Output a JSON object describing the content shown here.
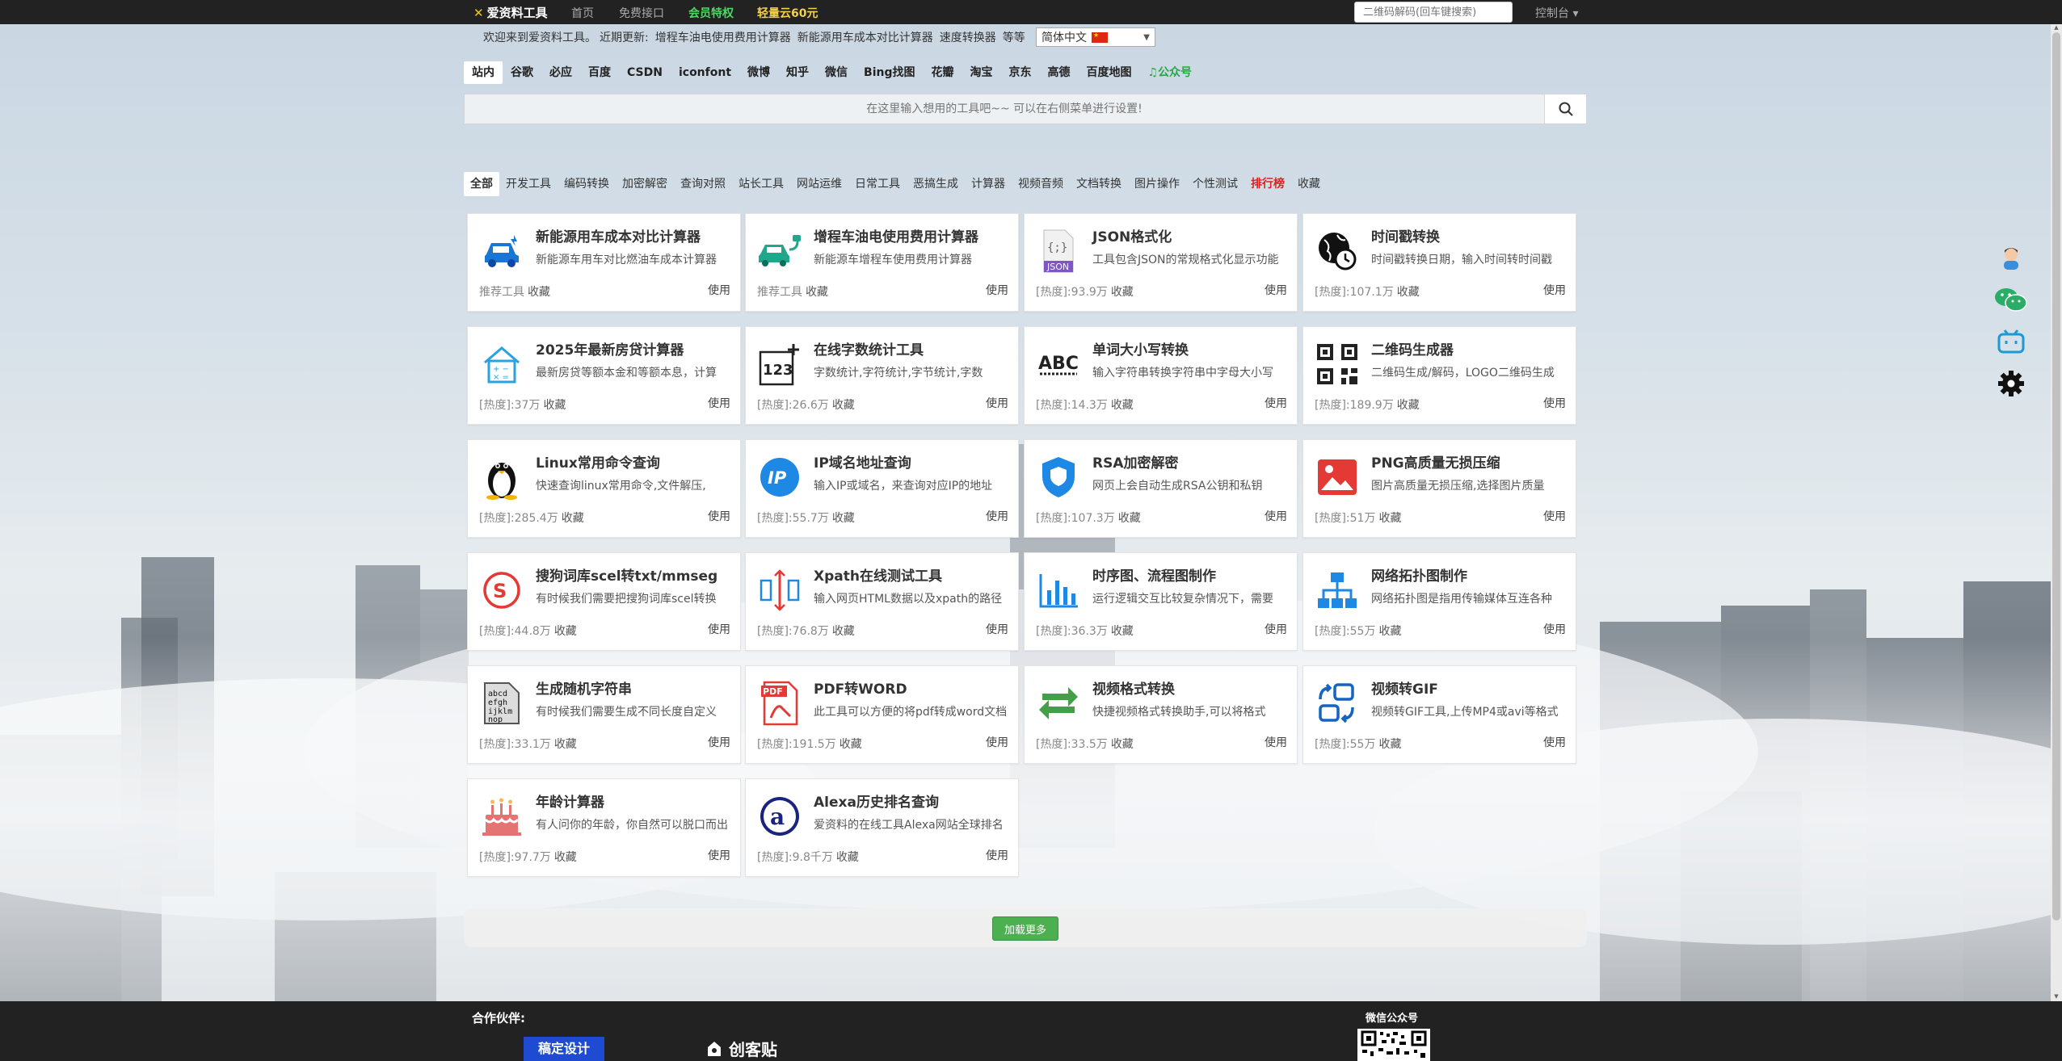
{
  "topbar": {
    "logo": "爱资料工具",
    "nav": [
      "首页",
      "免费接口",
      "会员特权",
      "轻量云60元"
    ],
    "qr_search_placeholder": "二维码解码(回车键搜索)",
    "console": "控制台 ▾"
  },
  "announce": {
    "welcome": "欢迎来到爱资料工具。",
    "recent_label": "近期更新:",
    "items": [
      "增程车油电使用费用计算器",
      "新能源用车成本对比计算器",
      "速度转换器",
      "等等"
    ],
    "language": "简体中文"
  },
  "engines": [
    "站内",
    "谷歌",
    "必应",
    "百度",
    "CSDN",
    "iconfont",
    "微博",
    "知乎",
    "微信",
    "Bing找图",
    "花瓣",
    "淘宝",
    "京东",
    "高德",
    "百度地图",
    "公众号"
  ],
  "search": {
    "placeholder": "在这里输入想用的工具吧~~ 可以在右侧菜单进行设置!"
  },
  "categories": [
    "全部",
    "开发工具",
    "编码转换",
    "加密解密",
    "查询对照",
    "站长工具",
    "网站运维",
    "日常工具",
    "恶搞生成",
    "计算器",
    "视频音频",
    "文档转换",
    "图片操作",
    "个性测试",
    "排行榜",
    "收藏"
  ],
  "cards": [
    {
      "title": "新能源用车成本对比计算器",
      "desc": "新能源车用车对比燃油车成本计算器",
      "meta": "推荐工具",
      "fav": "收藏",
      "use": "使用",
      "icon": "car-icon"
    },
    {
      "title": "增程车油电使用费用计算器",
      "desc": "新能源车增程车使用费用计算器",
      "meta": "推荐工具",
      "fav": "收藏",
      "use": "使用",
      "icon": "ev-charge-icon"
    },
    {
      "title": "JSON格式化",
      "desc": "工具包含JSON的常规格式化显示功能",
      "meta": "[热度]:93.9万",
      "fav": "收藏",
      "use": "使用",
      "icon": "json-file-icon"
    },
    {
      "title": "时间戳转换",
      "desc": "时间戳转换日期，输入时间转时间戳",
      "meta": "[热度]:107.1万",
      "fav": "收藏",
      "use": "使用",
      "icon": "globe-clock-icon"
    },
    {
      "title": "2025年最新房贷计算器",
      "desc": "最新房贷等额本金和等额本息，计算",
      "meta": "[热度]:37万",
      "fav": "收藏",
      "use": "使用",
      "icon": "house-calc-icon"
    },
    {
      "title": "在线字数统计工具",
      "desc": "字数统计,字符统计,字节统计,字数",
      "meta": "[热度]:26.6万",
      "fav": "收藏",
      "use": "使用",
      "icon": "count-123-icon"
    },
    {
      "title": "单词大小写转换",
      "desc": "输入字符串转换字符串中字母大小写",
      "meta": "[热度]:14.3万",
      "fav": "收藏",
      "use": "使用",
      "icon": "abc-icon"
    },
    {
      "title": "二维码生成器",
      "desc": "二维码生成/解码，LOGO二维码生成",
      "meta": "[热度]:189.9万",
      "fav": "收藏",
      "use": "使用",
      "icon": "qrcode-icon"
    },
    {
      "title": "Linux常用命令查询",
      "desc": "快速查询linux常用命令,文件解压,",
      "meta": "[热度]:285.4万",
      "fav": "收藏",
      "use": "使用",
      "icon": "tux-icon"
    },
    {
      "title": "IP域名地址查询",
      "desc": "输入IP或域名，来查询对应IP的地址",
      "meta": "[热度]:55.7万",
      "fav": "收藏",
      "use": "使用",
      "icon": "ip-icon"
    },
    {
      "title": "RSA加密解密",
      "desc": "网页上会自动生成RSA公钥和私钥",
      "meta": "[热度]:107.3万",
      "fav": "收藏",
      "use": "使用",
      "icon": "shield-icon"
    },
    {
      "title": "PNG高质量无损压缩",
      "desc": "图片高质量无损压缩,选择图片质量",
      "meta": "[热度]:51万",
      "fav": "收藏",
      "use": "使用",
      "icon": "image-icon"
    },
    {
      "title": "搜狗词库scel转txt/mmseg",
      "desc": "有时候我们需要把搜狗词库scel转换",
      "meta": "[热度]:44.8万",
      "fav": "收藏",
      "use": "使用",
      "icon": "sogou-icon"
    },
    {
      "title": "Xpath在线测试工具",
      "desc": "输入网页HTML数据以及xpath的路径",
      "meta": "[热度]:76.8万",
      "fav": "收藏",
      "use": "使用",
      "icon": "xpath-icon"
    },
    {
      "title": "时序图、流程图制作",
      "desc": "运行逻辑交互比较复杂情况下，需要",
      "meta": "[热度]:36.3万",
      "fav": "收藏",
      "use": "使用",
      "icon": "bar-chart-icon"
    },
    {
      "title": "网络拓扑图制作",
      "desc": "网络拓扑图是指用传输媒体互连各种",
      "meta": "[热度]:55万",
      "fav": "收藏",
      "use": "使用",
      "icon": "topology-icon"
    },
    {
      "title": "生成随机字符串",
      "desc": "有时候我们需要生成不同长度自定义",
      "meta": "[热度]:33.1万",
      "fav": "收藏",
      "use": "使用",
      "icon": "random-string-icon"
    },
    {
      "title": "PDF转WORD",
      "desc": "此工具可以方便的将pdf转成word文档",
      "meta": "[热度]:191.5万",
      "fav": "收藏",
      "use": "使用",
      "icon": "pdf-icon"
    },
    {
      "title": "视频格式转换",
      "desc": "快捷视频格式转换助手,可以将格式",
      "meta": "[热度]:33.5万",
      "fav": "收藏",
      "use": "使用",
      "icon": "convert-arrows-icon"
    },
    {
      "title": "视频转GIF",
      "desc": "视频转GIF工具,上传MP4或avi等格式",
      "meta": "[热度]:55万",
      "fav": "收藏",
      "use": "使用",
      "icon": "video-gif-icon"
    },
    {
      "title": "年龄计算器",
      "desc": "有人问你的年龄，你自然可以脱口而出",
      "meta": "[热度]:97.7万",
      "fav": "收藏",
      "use": "使用",
      "icon": "birthday-cake-icon"
    },
    {
      "title": "Alexa历史排名查询",
      "desc": "爱资料的在线工具Alexa网站全球排名",
      "meta": "[热度]:9.8千万",
      "fav": "收藏",
      "use": "使用",
      "icon": "alexa-icon"
    }
  ],
  "load_more": "加载更多",
  "floats": [
    "avatar-icon",
    "wechat-icon",
    "bilibili-icon",
    "settings-gear-icon"
  ],
  "footer": {
    "partners_title": "合作伙伴:",
    "partner1": "稿定设计",
    "partner2": "创客贴",
    "wechat_title": "微信公众号"
  },
  "colors": {
    "vip": "#4cd964",
    "yun": "#f5d04a",
    "load_more": "#4caf50",
    "rank": "#e02020"
  }
}
